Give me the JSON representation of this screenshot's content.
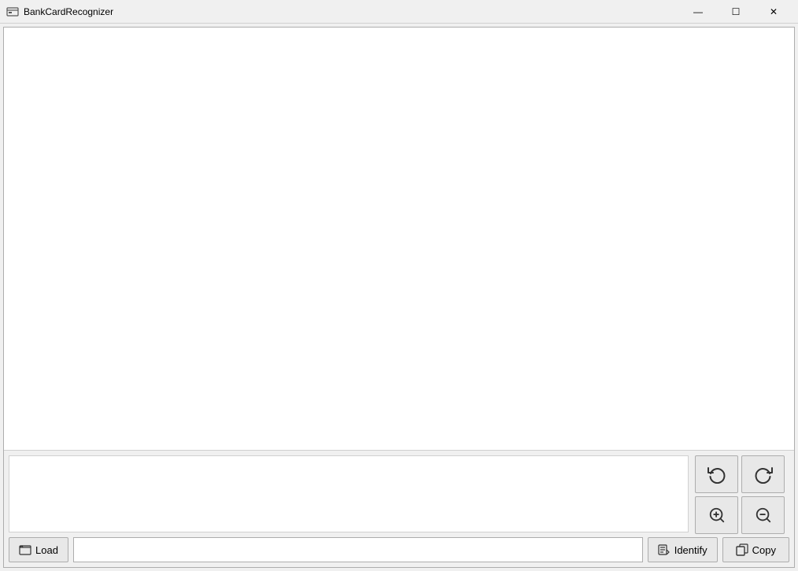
{
  "titleBar": {
    "title": "BankCardRecognizer",
    "iconLabel": "app-icon",
    "minimizeLabel": "—",
    "maximizeLabel": "☐",
    "closeLabel": "✕"
  },
  "toolbar": {
    "rotateCCWLabel": "↺",
    "rotateCWLabel": "↻",
    "zoomInLabel": "⊕",
    "zoomOutLabel": "⊖"
  },
  "actions": {
    "loadLabel": "Load",
    "identifyLabel": "Identify",
    "copyLabel": "Copy",
    "resultPlaceholder": "",
    "resultValue": ""
  }
}
